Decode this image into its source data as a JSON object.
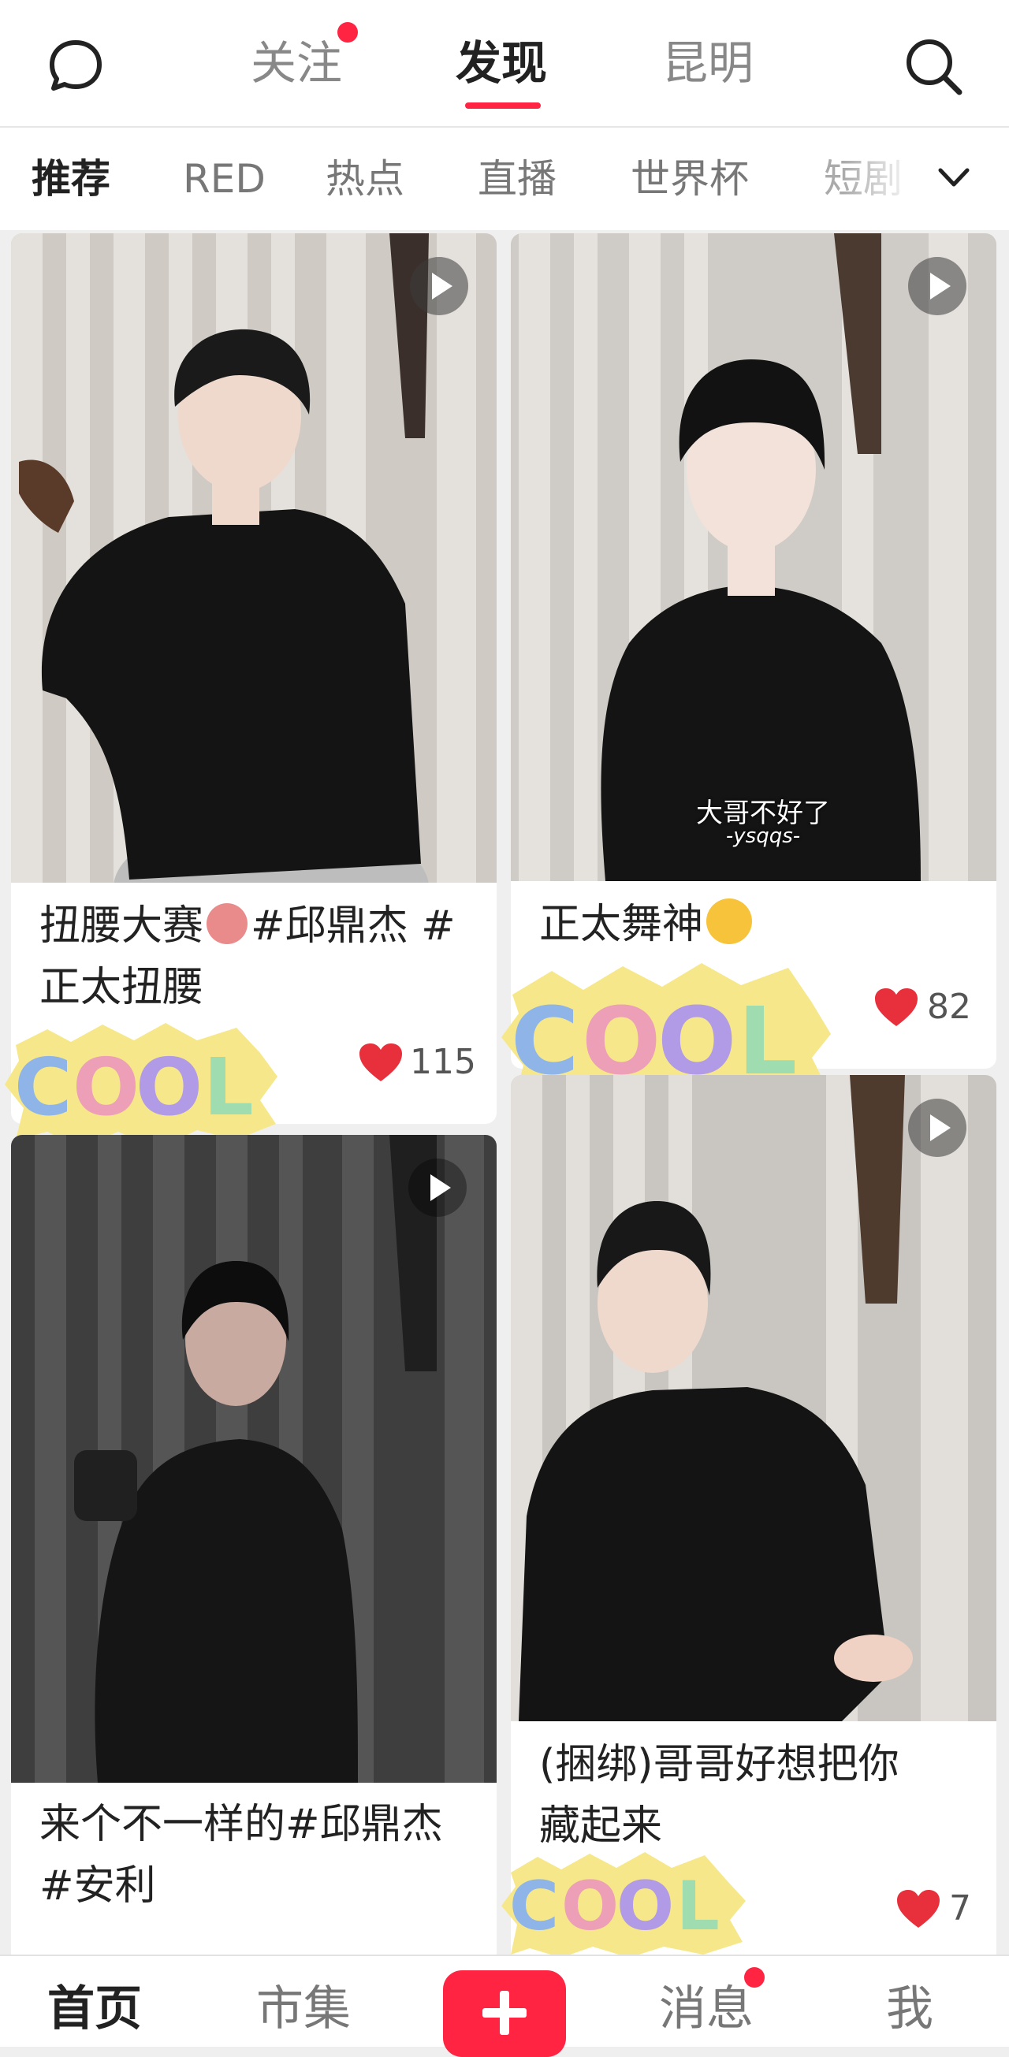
{
  "top_tabs": {
    "follow": "关注",
    "discover": "发现",
    "city": "昆明"
  },
  "categories": [
    "推荐",
    "RED",
    "热点",
    "直播",
    "世界杯",
    "短剧"
  ],
  "cards": [
    {
      "caption_line1": "扭腰大赛",
      "caption_tail1": "#邱鼎杰 #",
      "caption_line2": "正太扭腰",
      "likes": "115",
      "emoji": "pig-emoji",
      "sticker": "COOL"
    },
    {
      "caption_line1": "正太舞神",
      "likes": "82",
      "subtitle1": "大哥不好了",
      "subtitle2": "-ysqqs-",
      "emoji": "crazy-face-emoji",
      "sticker": "COOL"
    },
    {
      "caption_line1": "来个不一样的#邱鼎杰",
      "caption_line2": "#安利"
    },
    {
      "caption_line1": "(捆绑)哥哥好想把你",
      "caption_line2": "藏起来",
      "likes": "7",
      "sticker": "COOL"
    }
  ],
  "bottom_nav": {
    "home": "首页",
    "market": "市集",
    "messages": "消息",
    "me": "我"
  },
  "colors": {
    "accent": "#ff2442",
    "heart": "#e8303c"
  },
  "icons": [
    "chat-bubble-icon",
    "search-icon",
    "chevron-down-icon",
    "play-icon",
    "heart-icon",
    "plus-icon"
  ]
}
